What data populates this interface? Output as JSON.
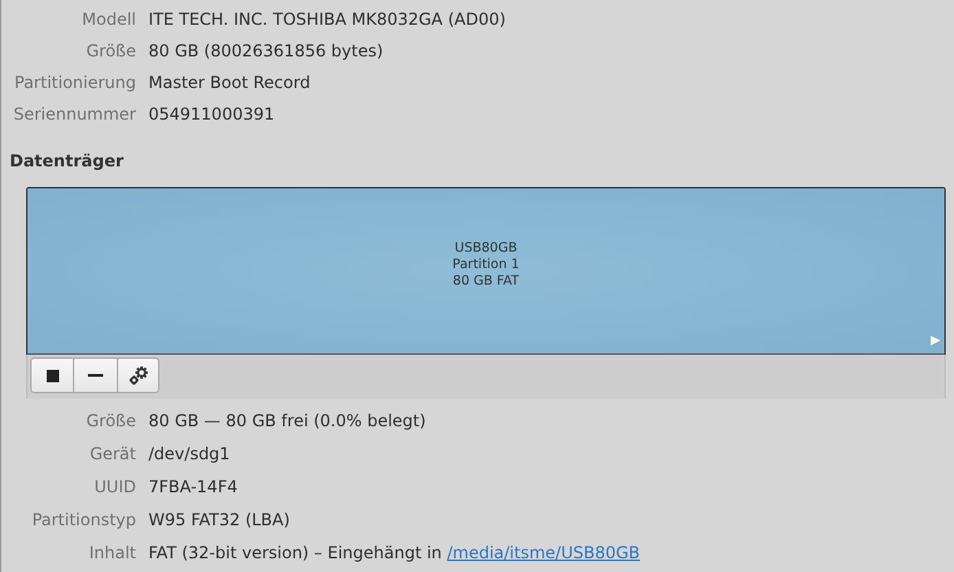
{
  "drive_info": [
    {
      "label": "Modell",
      "value": "ITE TECH. INC. TOSHIBA MK8032GA (AD00)"
    },
    {
      "label": "Größe",
      "value": "80 GB (80026361856 bytes)"
    },
    {
      "label": "Partitionierung",
      "value": "Master Boot Record"
    },
    {
      "label": "Seriennummer",
      "value": "054911000391"
    }
  ],
  "volumes": {
    "heading": "Datenträger",
    "partitions": [
      {
        "name": "USB80GB",
        "number": "Partition 1",
        "size": "80 GB FAT",
        "selected": true,
        "more": "▶"
      }
    ],
    "toolbar": [
      {
        "kind": "stop"
      },
      {
        "kind": "remove"
      },
      {
        "kind": "settings"
      }
    ]
  },
  "volume_info": [
    {
      "label": "Größe",
      "value": "80 GB — 80 GB frei (0.0% belegt)"
    },
    {
      "label": "Gerät",
      "value": "/dev/sdg1"
    },
    {
      "label": "UUID",
      "value": "7FBA-14F4"
    },
    {
      "label": "Partitionstyp",
      "value": "W95 FAT32 (LBA)"
    },
    {
      "label": "Inhalt",
      "value": "FAT (32-bit version) – Eingehängt in ",
      "link": "/media/itsme/USB80GB"
    }
  ]
}
